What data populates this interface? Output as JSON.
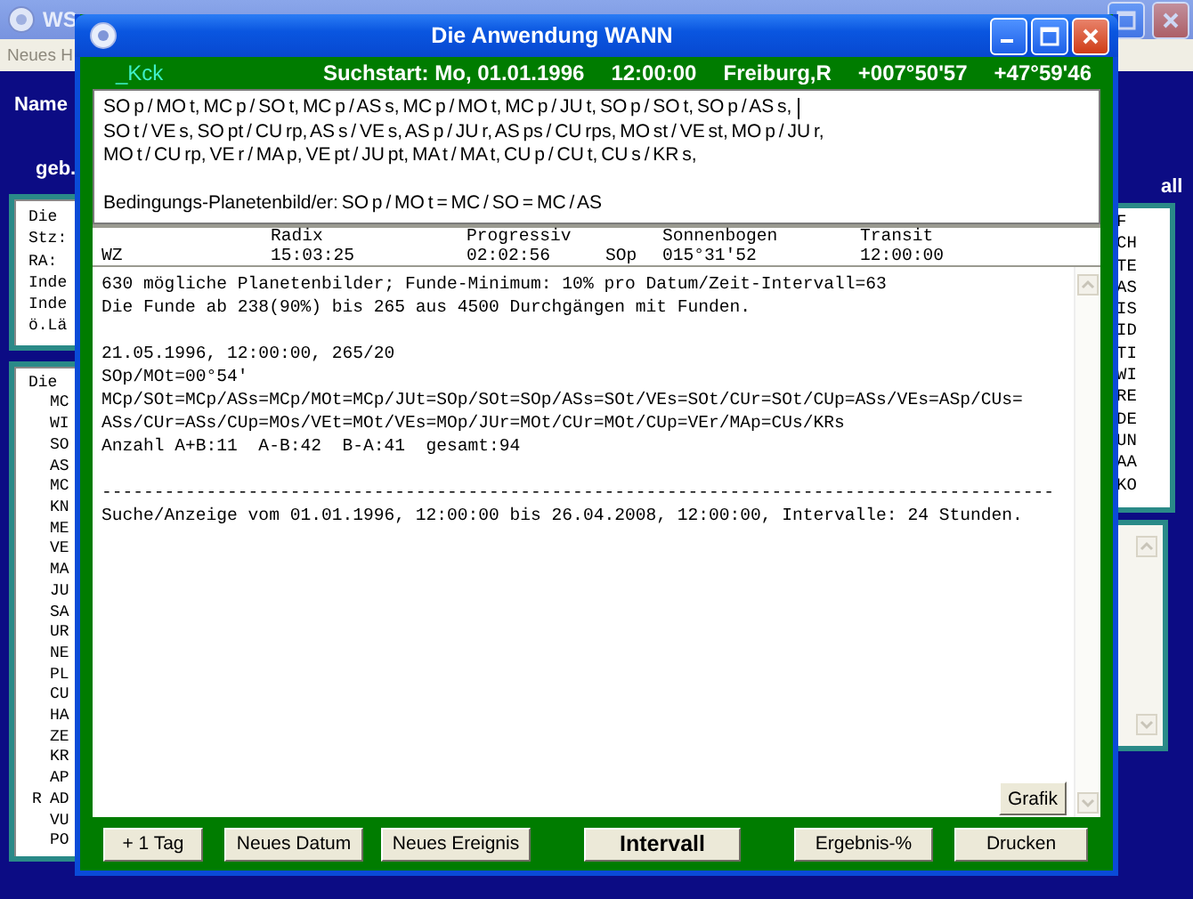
{
  "background_window": {
    "title": "WS",
    "menu": [
      "Neues H"
    ],
    "name_label": "Name",
    "birth_label": "geb.",
    "side_label": "all",
    "left_lists": [
      [
        {
          "text": "Die"
        },
        {
          "text": "Stz:"
        },
        {
          "text": "RA:"
        },
        {
          "text": "Inde"
        },
        {
          "text": "Inde"
        },
        {
          "text": "ö.Lä"
        }
      ],
      [
        {
          "text": "Die",
          "children": [
            {
              "text": "MC"
            },
            {
              "text": "WI"
            },
            {
              "text": "SO"
            },
            {
              "text": "AS"
            },
            {
              "text": "MC"
            },
            {
              "text": "KN"
            },
            {
              "text": "ME"
            },
            {
              "text": "VE"
            },
            {
              "text": "MA"
            },
            {
              "text": "JU"
            },
            {
              "text": "SA"
            },
            {
              "text": "UR"
            },
            {
              "text": "NE"
            },
            {
              "text": "PL"
            },
            {
              "text": "CU"
            },
            {
              "text": "HA"
            },
            {
              "text": "ZE"
            },
            {
              "text": "KR"
            },
            {
              "text": "AP"
            },
            {
              "text": "AD",
              "flag": "R"
            },
            {
              "text": "VU"
            },
            {
              "text": "PO"
            }
          ]
        }
      ]
    ],
    "right_lists": [
      [
        "F",
        "CH",
        "TE",
        "AS",
        "IS",
        "ID",
        "TI",
        "WI",
        "RE",
        "DE",
        "UN",
        "AA",
        "KO"
      ]
    ]
  },
  "dialog": {
    "title": "Die Anwendung WANN",
    "header": {
      "code": "_Kck",
      "items": [
        "Suchstart: Mo, 01.01.1996",
        "12:00:00",
        "Freiburg,R",
        "+007°50'57",
        "+47°59'46"
      ]
    },
    "conditions": {
      "lines": [
        "SO p / MO t, MC p / SO t, MC p / AS s, MC p / MO t, MC p / JU t, SO p / SO t, SO p / AS s,",
        "SO t / VE s, SO pt / CU rp, AS s / VE s, AS p / JU r, AS ps / CU rps, MO st / VE st, MO p / JU r,",
        "MO t / CU rp, VE r / MA p, VE pt / JU pt, MA t / MA t, CU p / CU t, CU s / KR s,"
      ],
      "condition": "Bedingungs-Planetenbild/er: SO p / MO t = MC / SO = MC / AS"
    },
    "table": {
      "columns": [
        "Radix",
        "Progressiv",
        "Sonnenbogen",
        "Transit"
      ],
      "row": [
        "WZ",
        "15:03:25",
        "02:02:56",
        "SOp",
        "015°31'52",
        "12:00:00"
      ]
    },
    "output": {
      "blocks": [
        [
          "630 mögliche Planetenbilder; Funde-Minimum: 10% pro Datum/Zeit-Intervall=63",
          "Die Funde ab 238(90%) bis 265 aus 4500 Durchgängen mit Funden."
        ],
        [
          "21.05.1996, 12:00:00, 265/20",
          "SOp/MOt=00°54'",
          "MCp/SOt=MCp/ASs=MCp/MOt=MCp/JUt=SOp/SOt=SOp/ASs=SOt/VEs=SOt/CUr=SOt/CUp=ASs/VEs=ASp/CUs=",
          "ASs/CUr=ASs/CUp=MOs/VEt=MOt/VEs=MOp/JUr=MOt/CUr=MOt/CUp=VEr/MAp=CUs/KRs",
          "Anzahl A+B:11  A-B:42  B-A:41  gesamt:94"
        ],
        [
          "-------------------------------------------------------------------------------------------",
          "Suche/Anzeige vom 01.01.1996, 12:00:00 bis 26.04.2008, 12:00:00, Intervalle: 24 Stunden."
        ]
      ],
      "graph_button": "Grafik"
    },
    "buttons": [
      {
        "label": "+ 1 Tag",
        "default": false
      },
      {
        "label": "Neues Datum",
        "default": false
      },
      {
        "label": "Neues Ereignis",
        "default": false
      },
      {
        "label": "Intervall",
        "default": true
      },
      {
        "label": "Ergebnis-%",
        "default": false
      },
      {
        "label": "Drucken",
        "default": false
      }
    ]
  }
}
